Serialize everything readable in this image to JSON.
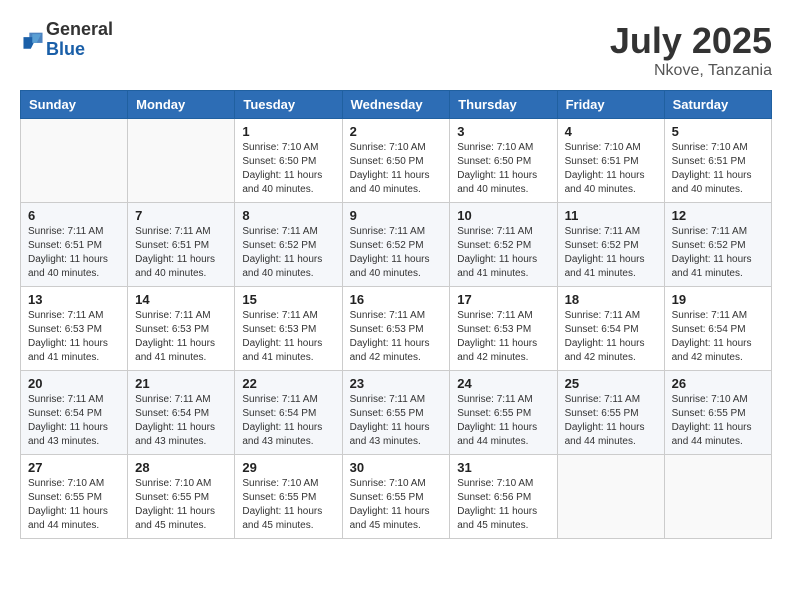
{
  "logo": {
    "general": "General",
    "blue": "Blue"
  },
  "title": {
    "month": "July 2025",
    "location": "Nkove, Tanzania"
  },
  "weekdays": [
    "Sunday",
    "Monday",
    "Tuesday",
    "Wednesday",
    "Thursday",
    "Friday",
    "Saturday"
  ],
  "weeks": [
    [
      {
        "day": "",
        "info": ""
      },
      {
        "day": "",
        "info": ""
      },
      {
        "day": "1",
        "info": "Sunrise: 7:10 AM\nSunset: 6:50 PM\nDaylight: 11 hours and 40 minutes."
      },
      {
        "day": "2",
        "info": "Sunrise: 7:10 AM\nSunset: 6:50 PM\nDaylight: 11 hours and 40 minutes."
      },
      {
        "day": "3",
        "info": "Sunrise: 7:10 AM\nSunset: 6:50 PM\nDaylight: 11 hours and 40 minutes."
      },
      {
        "day": "4",
        "info": "Sunrise: 7:10 AM\nSunset: 6:51 PM\nDaylight: 11 hours and 40 minutes."
      },
      {
        "day": "5",
        "info": "Sunrise: 7:10 AM\nSunset: 6:51 PM\nDaylight: 11 hours and 40 minutes."
      }
    ],
    [
      {
        "day": "6",
        "info": "Sunrise: 7:11 AM\nSunset: 6:51 PM\nDaylight: 11 hours and 40 minutes."
      },
      {
        "day": "7",
        "info": "Sunrise: 7:11 AM\nSunset: 6:51 PM\nDaylight: 11 hours and 40 minutes."
      },
      {
        "day": "8",
        "info": "Sunrise: 7:11 AM\nSunset: 6:52 PM\nDaylight: 11 hours and 40 minutes."
      },
      {
        "day": "9",
        "info": "Sunrise: 7:11 AM\nSunset: 6:52 PM\nDaylight: 11 hours and 40 minutes."
      },
      {
        "day": "10",
        "info": "Sunrise: 7:11 AM\nSunset: 6:52 PM\nDaylight: 11 hours and 41 minutes."
      },
      {
        "day": "11",
        "info": "Sunrise: 7:11 AM\nSunset: 6:52 PM\nDaylight: 11 hours and 41 minutes."
      },
      {
        "day": "12",
        "info": "Sunrise: 7:11 AM\nSunset: 6:52 PM\nDaylight: 11 hours and 41 minutes."
      }
    ],
    [
      {
        "day": "13",
        "info": "Sunrise: 7:11 AM\nSunset: 6:53 PM\nDaylight: 11 hours and 41 minutes."
      },
      {
        "day": "14",
        "info": "Sunrise: 7:11 AM\nSunset: 6:53 PM\nDaylight: 11 hours and 41 minutes."
      },
      {
        "day": "15",
        "info": "Sunrise: 7:11 AM\nSunset: 6:53 PM\nDaylight: 11 hours and 41 minutes."
      },
      {
        "day": "16",
        "info": "Sunrise: 7:11 AM\nSunset: 6:53 PM\nDaylight: 11 hours and 42 minutes."
      },
      {
        "day": "17",
        "info": "Sunrise: 7:11 AM\nSunset: 6:53 PM\nDaylight: 11 hours and 42 minutes."
      },
      {
        "day": "18",
        "info": "Sunrise: 7:11 AM\nSunset: 6:54 PM\nDaylight: 11 hours and 42 minutes."
      },
      {
        "day": "19",
        "info": "Sunrise: 7:11 AM\nSunset: 6:54 PM\nDaylight: 11 hours and 42 minutes."
      }
    ],
    [
      {
        "day": "20",
        "info": "Sunrise: 7:11 AM\nSunset: 6:54 PM\nDaylight: 11 hours and 43 minutes."
      },
      {
        "day": "21",
        "info": "Sunrise: 7:11 AM\nSunset: 6:54 PM\nDaylight: 11 hours and 43 minutes."
      },
      {
        "day": "22",
        "info": "Sunrise: 7:11 AM\nSunset: 6:54 PM\nDaylight: 11 hours and 43 minutes."
      },
      {
        "day": "23",
        "info": "Sunrise: 7:11 AM\nSunset: 6:55 PM\nDaylight: 11 hours and 43 minutes."
      },
      {
        "day": "24",
        "info": "Sunrise: 7:11 AM\nSunset: 6:55 PM\nDaylight: 11 hours and 44 minutes."
      },
      {
        "day": "25",
        "info": "Sunrise: 7:11 AM\nSunset: 6:55 PM\nDaylight: 11 hours and 44 minutes."
      },
      {
        "day": "26",
        "info": "Sunrise: 7:10 AM\nSunset: 6:55 PM\nDaylight: 11 hours and 44 minutes."
      }
    ],
    [
      {
        "day": "27",
        "info": "Sunrise: 7:10 AM\nSunset: 6:55 PM\nDaylight: 11 hours and 44 minutes."
      },
      {
        "day": "28",
        "info": "Sunrise: 7:10 AM\nSunset: 6:55 PM\nDaylight: 11 hours and 45 minutes."
      },
      {
        "day": "29",
        "info": "Sunrise: 7:10 AM\nSunset: 6:55 PM\nDaylight: 11 hours and 45 minutes."
      },
      {
        "day": "30",
        "info": "Sunrise: 7:10 AM\nSunset: 6:55 PM\nDaylight: 11 hours and 45 minutes."
      },
      {
        "day": "31",
        "info": "Sunrise: 7:10 AM\nSunset: 6:56 PM\nDaylight: 11 hours and 45 minutes."
      },
      {
        "day": "",
        "info": ""
      },
      {
        "day": "",
        "info": ""
      }
    ]
  ]
}
